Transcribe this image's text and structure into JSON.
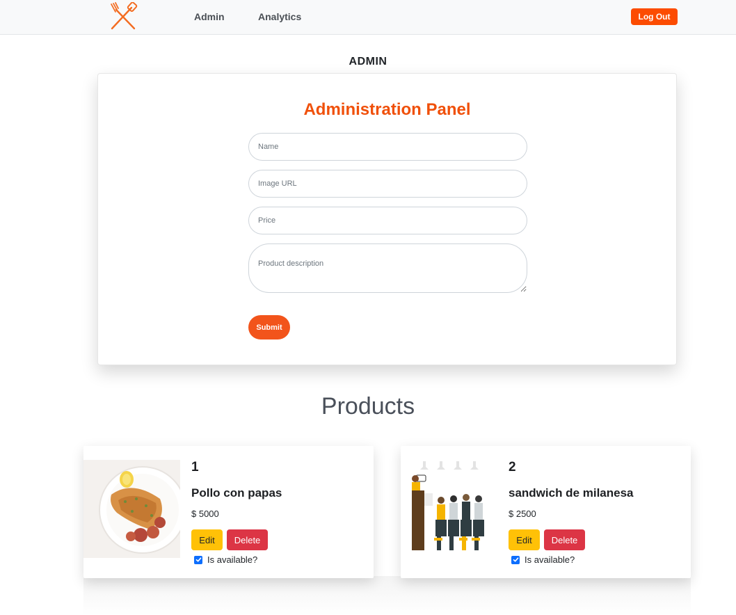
{
  "navbar": {
    "logo_icon": "crossed-fork-spatula-icon",
    "links": [
      {
        "label": "Admin"
      },
      {
        "label": "Analytics"
      }
    ],
    "logout_label": "Log Out",
    "accent_color": "#fc4c02"
  },
  "page_heading": "ADMIN",
  "panel": {
    "title": "Administration Panel",
    "fields": {
      "name_placeholder": "Name",
      "image_placeholder": "Image URL",
      "price_placeholder": "Price",
      "description_placeholder": "Product description"
    },
    "submit_label": "Submit"
  },
  "products": {
    "title": "Products",
    "items": [
      {
        "id": "1",
        "name": "Pollo con papas",
        "price": "$ 5000",
        "edit_label": "Edit",
        "delete_label": "Delete",
        "available": true,
        "available_label": "Is available?",
        "image_icon": "grilled-chicken-plate-image"
      },
      {
        "id": "2",
        "name": "sandwich de milanesa",
        "price": "$ 2500",
        "edit_label": "Edit",
        "delete_label": "Delete",
        "available": true,
        "available_label": "Is available?",
        "image_icon": "people-seminar-illustration"
      }
    ]
  },
  "colors": {
    "brand_orange": "#f0500a",
    "edit_yellow": "#ffc107",
    "delete_red": "#dc3545",
    "checkbox_blue": "#0d6efd"
  }
}
